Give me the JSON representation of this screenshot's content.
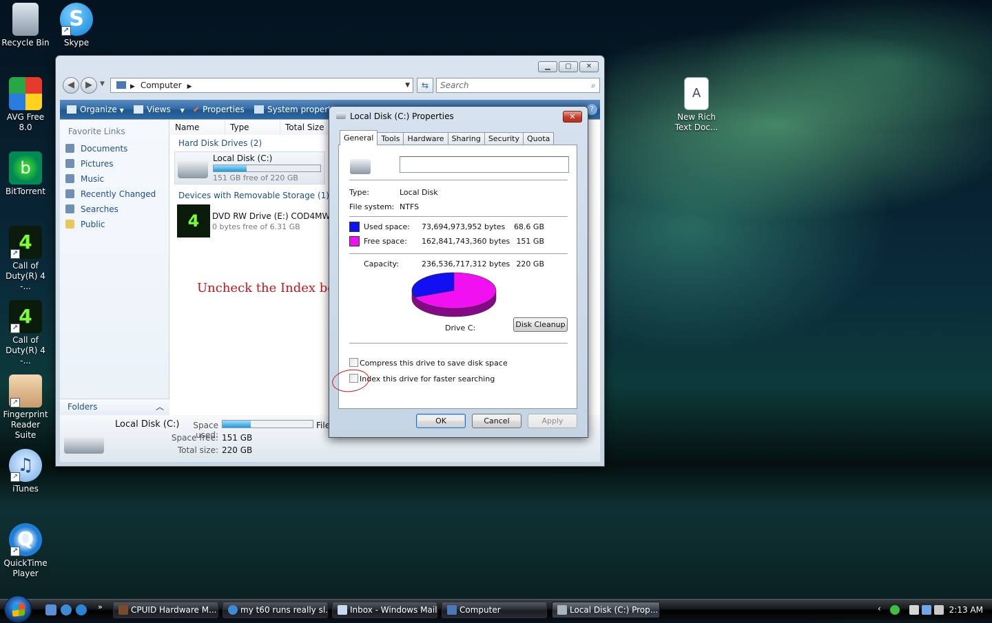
{
  "desktop": {
    "icons": [
      {
        "label": "Recycle Bin",
        "icon": "recycle-bin-icon"
      },
      {
        "label": "Skype",
        "icon": "skype-icon"
      },
      {
        "label": "AVG Free 8.0",
        "icon": "avg-icon"
      },
      {
        "label": "BitTorrent",
        "icon": "bittorrent-icon"
      },
      {
        "label": "Call of Duty(R) 4 -...",
        "icon": "cod4-icon"
      },
      {
        "label": "Call of Duty(R) 4 -...",
        "icon": "cod4-icon"
      },
      {
        "label": "Fingerprint Reader Suite",
        "icon": "fingerprint-icon"
      },
      {
        "label": "iTunes",
        "icon": "itunes-icon"
      },
      {
        "label": "QuickTime Player",
        "icon": "quicktime-icon"
      },
      {
        "label": "New Rich Text Doc...",
        "icon": "rich-text-document-icon"
      }
    ]
  },
  "explorer": {
    "address": "Computer",
    "search_placeholder": "Search",
    "toolbar": {
      "organize": "Organize",
      "views": "Views",
      "properties": "Properties",
      "system_properties": "System properti"
    },
    "favorite_links_title": "Favorite Links",
    "favorite_links": [
      "Documents",
      "Pictures",
      "Music",
      "Recently Changed",
      "Searches",
      "Public"
    ],
    "folders_label": "Folders",
    "columns": [
      "Name",
      "Type",
      "Total Size"
    ],
    "groups": {
      "hard_disk": "Hard Disk Drives (2)",
      "removable": "Devices with Removable Storage (1)"
    },
    "drives": [
      {
        "name": "Local Disk (C:)",
        "sub": "151 GB free of 220 GB",
        "used_fraction": 0.31
      },
      {
        "name": "DVD RW Drive (E:) COD4MW",
        "sub": "0 bytes free of 6.31 GB"
      }
    ],
    "details": {
      "name": "Local Disk (C:)",
      "space_used_label": "Space used:",
      "space_used_fraction": 0.31,
      "file_label": "File",
      "space_free_label": "Space free:",
      "space_free": "151 GB",
      "total_size_label": "Total size:",
      "total_size": "220 GB"
    }
  },
  "annotation": {
    "text": "Uncheck the Index box",
    "color": "#c3141a"
  },
  "properties": {
    "title": "Local Disk (C:) Properties",
    "close_label": "✕",
    "tabs": [
      "General",
      "Tools",
      "Hardware",
      "Sharing",
      "Security",
      "Quota"
    ],
    "active_tab": "General",
    "label_value": "",
    "type_label": "Type:",
    "type_value": "Local Disk",
    "fs_label": "File system:",
    "fs_value": "NTFS",
    "used_label": "Used space:",
    "used_bytes": "73,694,973,952 bytes",
    "used_gb": "68.6 GB",
    "free_label": "Free space:",
    "free_bytes": "162,841,743,360 bytes",
    "free_gb": "151 GB",
    "capacity_label": "Capacity:",
    "capacity_bytes": "236,536,717,312 bytes",
    "capacity_gb": "220 GB",
    "drive_label": "Drive C:",
    "disk_cleanup": "Disk Cleanup",
    "compress_label": "Compress this drive to save disk space",
    "compress_checked": false,
    "index_label": "Index this drive for faster searching",
    "index_checked": false,
    "ok": "OK",
    "cancel": "Cancel",
    "apply": "Apply",
    "used_color": "#1010f0",
    "free_color": "#f010f0",
    "used_fraction": 0.3116
  },
  "taskbar": {
    "tasks": [
      {
        "label": "CPUID Hardware M..."
      },
      {
        "label": "my t60 runs really sl..."
      },
      {
        "label": "Inbox - Windows Mail"
      },
      {
        "label": "Computer"
      },
      {
        "label": "Local Disk (C:) Prop..."
      }
    ],
    "clock": "2:13 AM"
  }
}
